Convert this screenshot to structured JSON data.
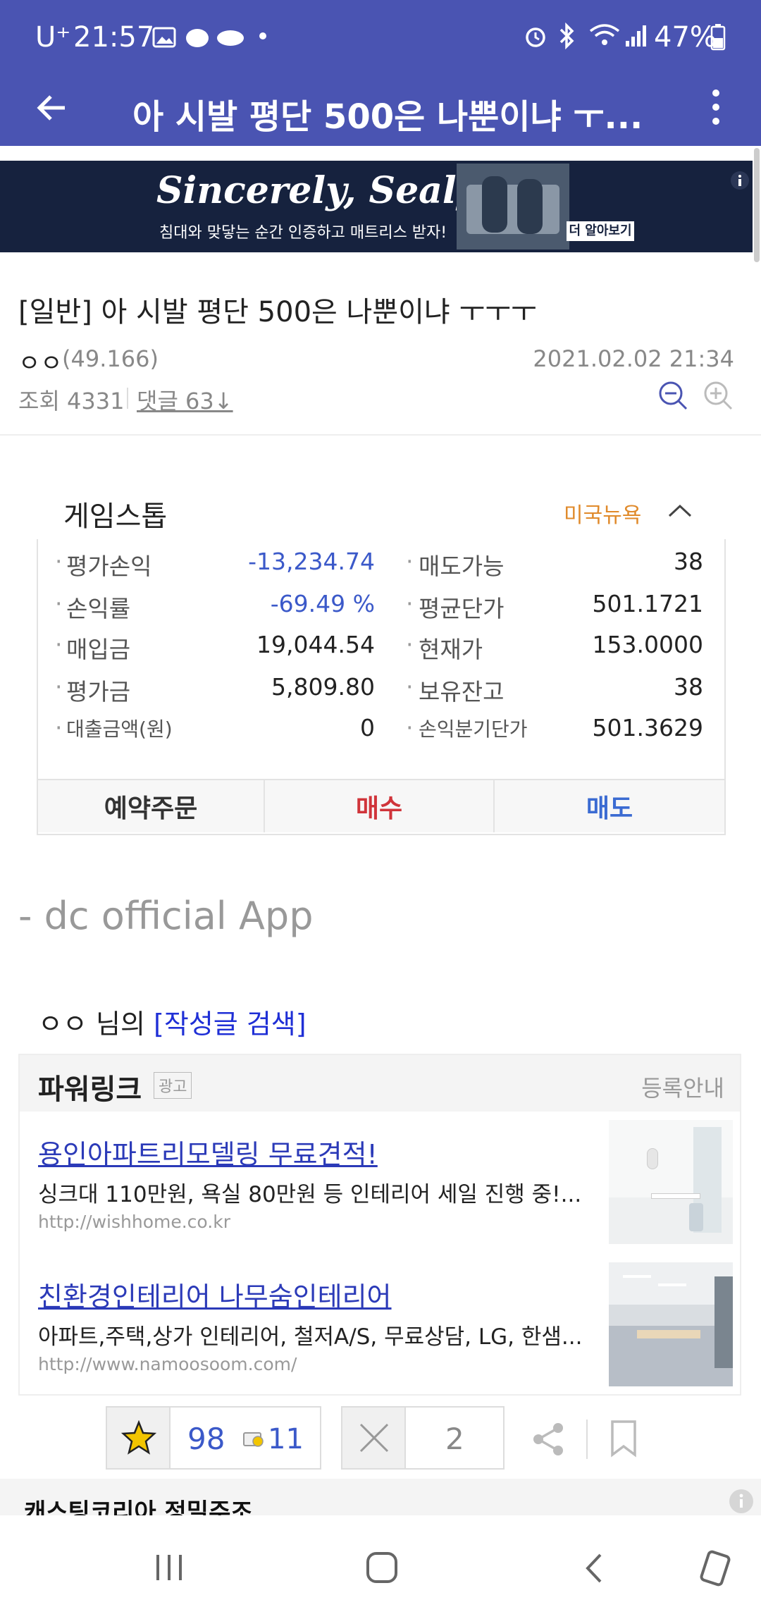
{
  "status_bar": {
    "carrier": "U⁺",
    "time": "21:57",
    "battery": "47%"
  },
  "app_bar": {
    "title": "아 시발 평단 500은 나뿐이냐 ㅜ..."
  },
  "banner": {
    "brand": "Sincerely, Sealy",
    "tagline": "침대와 맞닿는 순간 인증하고 매트리스 받자!",
    "cta": "더 알아보기"
  },
  "post": {
    "title": "[일반] 아 시발 평단 500은 나뿐이냐 ㅜㅜㅜ",
    "author": "ㅇㅇ",
    "ip": "(49.166)",
    "date": "2021.02.02 21:34",
    "views_label": "조회 4331",
    "comments_label": "댓글 63↓"
  },
  "stock": {
    "name": "게임스톱",
    "market_tag": "미국뉴욕",
    "rows": [
      {
        "l1": "평가손익",
        "v1": "-13,234.74",
        "l2": "매도가능",
        "v2": "38"
      },
      {
        "l1": "손익률",
        "v1": "-69.49 %",
        "l2": "평균단가",
        "v2": "501.1721"
      },
      {
        "l1": "매입금",
        "v1": "19,044.54",
        "l2": "현재가",
        "v2": "153.0000"
      },
      {
        "l1": "평가금",
        "v1": "5,809.80",
        "l2": "보유잔고",
        "v2": "38"
      },
      {
        "l1": "대출금액(원)",
        "v1": "0",
        "l2": "손익분기단가",
        "v2": "501.3629"
      }
    ],
    "buttons": {
      "reserve": "예약주문",
      "buy": "매수",
      "sell": "매도"
    }
  },
  "signature": "- dc official App",
  "author_search": {
    "name": "ㅇㅇ",
    "suffix": "님의",
    "link": "[작성글 검색]"
  },
  "powerlink": {
    "title": "파워링크",
    "ad_badge": "광고",
    "register": "등록안내",
    "ads": [
      {
        "title": "용인아파트리모델링 무료견적!",
        "desc": "싱크대 110만원, 욕실 80만원 등 인테리어 세일 진행 중!...",
        "url": "http://wishhome.co.kr"
      },
      {
        "title": "친환경인테리어 나무숨인테리어",
        "desc": "아파트,주택,상가 인테리어, 철저A/S, 무료상담, LG, 한샘...",
        "url": "http://www.namoosoom.com/"
      }
    ]
  },
  "reactions": {
    "recommend": "98",
    "fixed_recommend": "11",
    "not_recommend": "2"
  },
  "next_section": "캐스팅코리아 정밀주조",
  "colors": {
    "app_bar": "#4a54b2",
    "negative_value": "#3b59c9",
    "buy": "#d0343a",
    "sell": "#3b6bd2",
    "link": "#2b3ab8",
    "market_tag": "#e08a2b"
  }
}
